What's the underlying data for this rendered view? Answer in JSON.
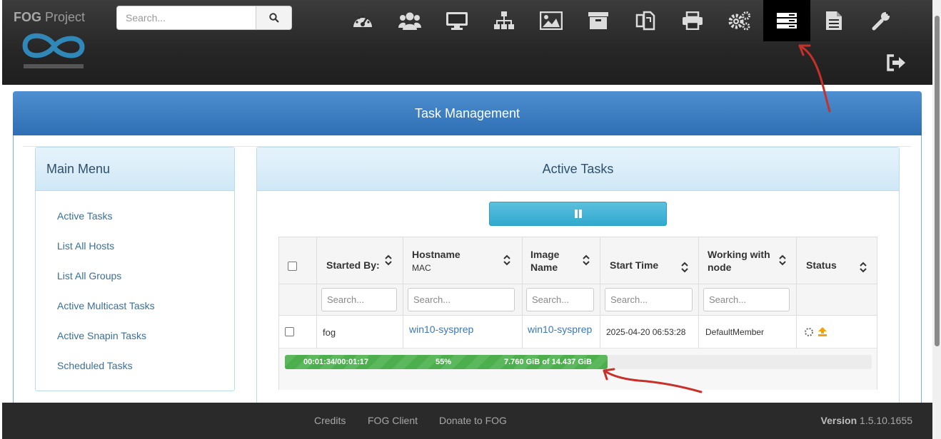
{
  "brand": {
    "name_bold": "FOG",
    "name_rest": " Project"
  },
  "search": {
    "placeholder": "Search..."
  },
  "nav_icons": [
    "dashboard-icon",
    "users-icon",
    "hosts-monitor-icon",
    "groups-sitemap-icon",
    "images-icon",
    "storage-archive-icon",
    "snapins-icon",
    "printer-icon",
    "plugins-gears-icon",
    "tasks-icon",
    "reports-icon",
    "settings-wrench-icon"
  ],
  "page_title": "Task Management",
  "menu": {
    "title": "Main Menu",
    "items": [
      "Active Tasks",
      "List All Hosts",
      "List All Groups",
      "Active Multicast Tasks",
      "Active Snapin Tasks",
      "Scheduled Tasks"
    ]
  },
  "tasks": {
    "title": "Active Tasks",
    "columns": {
      "started_by": "Started By:",
      "hostname": "Hostname",
      "mac": "MAC",
      "image": "Image",
      "image2": "Name",
      "start_time": "Start Time",
      "working": "Working with",
      "working2": "node",
      "status": "Status"
    },
    "filter_placeholder": "Search...",
    "row": {
      "started_by": "fog",
      "hostname": "win10-sysprep",
      "image_name": "win10-sysprep",
      "start_time": "2025-04-20 06:53:28",
      "node": "DefaultMember"
    },
    "progress": {
      "percent": 55,
      "elapsed": "00:01:34/00:01:17",
      "percent_label": "55%",
      "size": "7.760 GiB of 14.437 GiB"
    }
  },
  "footer": {
    "links": [
      "Credits",
      "FOG Client",
      "Donate to FOG"
    ],
    "version_label": "Version",
    "version": "1.5.10.1655"
  },
  "colors": {
    "accent_blue": "#2e6fb3",
    "progress_green": "#5cb85c",
    "pause_button": "#5bc0de",
    "navbar": "#262626"
  }
}
